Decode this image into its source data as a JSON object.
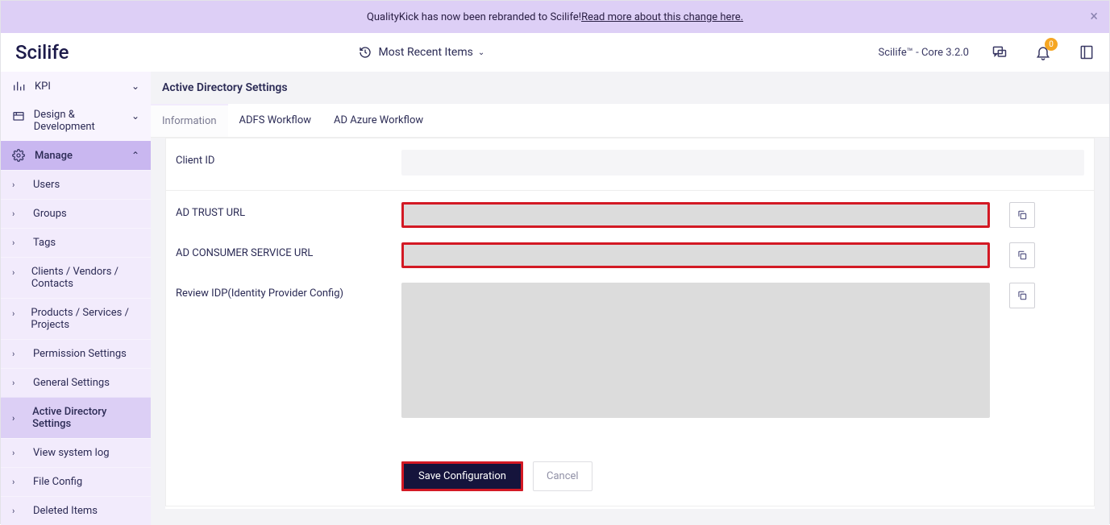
{
  "banner": {
    "text_before": "QualityKick has now been rebranded to Scilife! ",
    "link_text": "Read more about this change here."
  },
  "header": {
    "logo": "Scilife",
    "recent": "Most Recent Items",
    "version": "Scilife™ - Core 3.2.0",
    "notification_count": "0"
  },
  "sidebar": {
    "sections": [
      {
        "label": "KPI"
      },
      {
        "label": "Design & Development"
      },
      {
        "label": "Manage"
      }
    ],
    "manage_items": [
      {
        "label": "Users"
      },
      {
        "label": "Groups"
      },
      {
        "label": "Tags"
      },
      {
        "label": "Clients / Vendors / Contacts"
      },
      {
        "label": "Products / Services / Projects"
      },
      {
        "label": "Permission Settings"
      },
      {
        "label": "General Settings"
      },
      {
        "label": "Active Directory Settings"
      },
      {
        "label": "View system log"
      },
      {
        "label": "File Config"
      },
      {
        "label": "Deleted Items"
      }
    ]
  },
  "page": {
    "title": "Active Directory Settings",
    "tabs": [
      {
        "label": "Information"
      },
      {
        "label": "ADFS Workflow"
      },
      {
        "label": "AD Azure Workflow"
      }
    ]
  },
  "form": {
    "client_id_label": "Client ID",
    "client_id_value": "",
    "ad_trust_label": "AD TRUST URL",
    "ad_trust_value": "",
    "ad_consumer_label": "AD CONSUMER SERVICE URL",
    "ad_consumer_value": "",
    "review_idp_label": "Review IDP(Identity Provider Config)",
    "review_idp_value": "",
    "save": "Save Configuration",
    "cancel": "Cancel"
  }
}
